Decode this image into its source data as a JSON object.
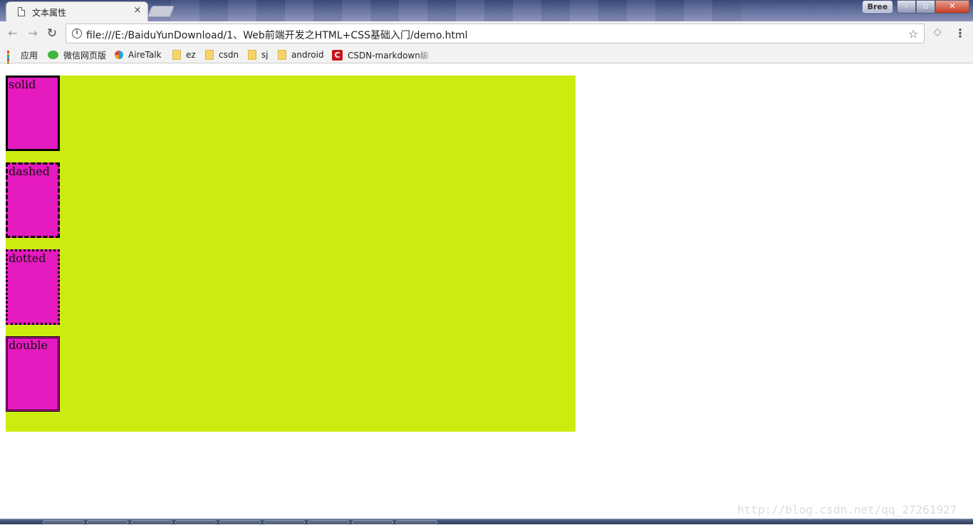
{
  "browser": {
    "tab_title": "文本属性",
    "tab_close": "×",
    "user_badge": "Bree",
    "window_buttons": {
      "minimize": "–",
      "maximize": "▫",
      "close": "✕"
    },
    "url": "file:///E:/BaiduYunDownload/1、Web前端开发之HTML+CSS基础入门/demo.html",
    "icons": {
      "back": "←",
      "forward": "→",
      "reload": "↻",
      "info": "i",
      "star": "☆",
      "extension": "◇",
      "menu": "⋮"
    }
  },
  "bookmarks": [
    {
      "label": "应用",
      "icon": "apps-icon"
    },
    {
      "label": "微信网页版",
      "icon": "wechat-icon"
    },
    {
      "label": "AireTalk",
      "icon": "airetalk-icon"
    },
    {
      "label": "ez",
      "icon": "folder-icon"
    },
    {
      "label": "csdn",
      "icon": "folder-icon"
    },
    {
      "label": "sj",
      "icon": "folder-icon"
    },
    {
      "label": "android",
      "icon": "folder-icon"
    },
    {
      "label": "CSDN-markdown编",
      "icon": "csdn-icon"
    }
  ],
  "page": {
    "container_color": "#ccec10",
    "box_color": "#e51abf",
    "boxes": [
      {
        "label": "solid",
        "border_style": "solid"
      },
      {
        "label": "dashed",
        "border_style": "dashed"
      },
      {
        "label": "dotted",
        "border_style": "dotted"
      },
      {
        "label": "double",
        "border_style": "double"
      }
    ]
  },
  "watermark": "http://blog.csdn.net/qq_27261927"
}
